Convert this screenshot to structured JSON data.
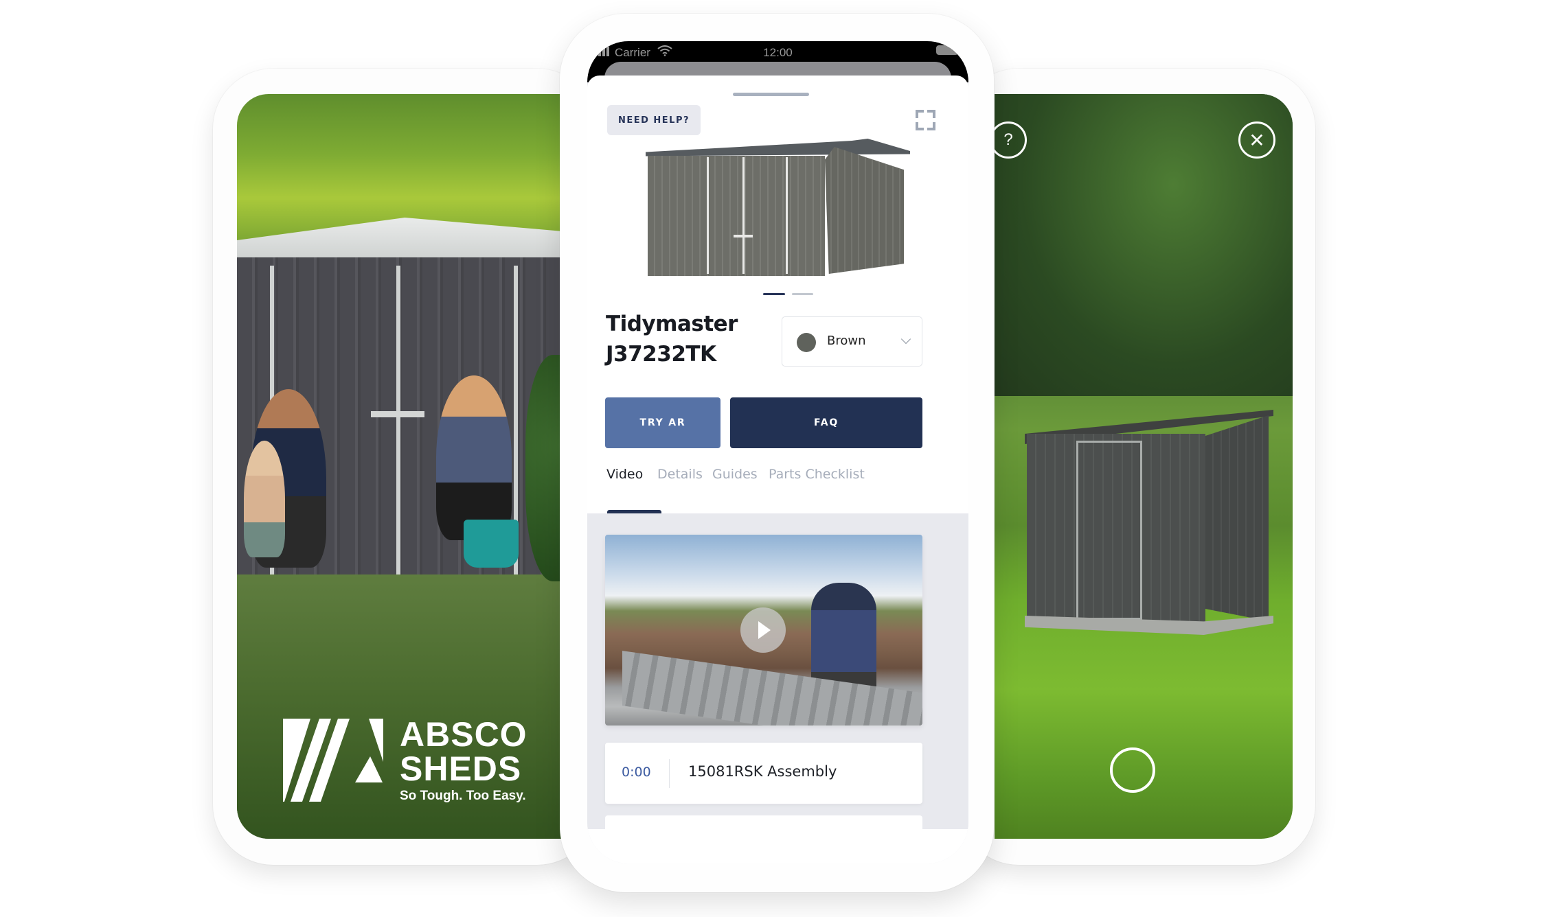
{
  "left_phone": {
    "brand": {
      "line1": "ABSCO",
      "line2": "SHEDS",
      "tagline": "So Tough. Too Easy."
    },
    "scene": "family-with-shed-photo"
  },
  "center_phone": {
    "status_bar": {
      "carrier": "Carrier",
      "time": "12:00",
      "icons": [
        "signal-icon",
        "wifi-icon",
        "battery-icon"
      ]
    },
    "header": {
      "help_button": "NEED HELP?",
      "fullscreen_icon": "fullscreen-icon"
    },
    "product": {
      "title": "Tidymaster J37232TK",
      "carousel": {
        "total": 2,
        "active": 1
      },
      "color": {
        "label": "Brown",
        "swatch": "#5f625c"
      }
    },
    "actions": {
      "try_ar": "TRY AR",
      "faq": "FAQ"
    },
    "tabs": [
      {
        "label": "Video",
        "active": true
      },
      {
        "label": "Details",
        "active": false
      },
      {
        "label": "Guides",
        "active": false
      },
      {
        "label": "Parts Checklist",
        "active": false
      }
    ],
    "videos": [
      {
        "time": "0:00",
        "title": "15081RSK Assembly"
      }
    ]
  },
  "right_phone": {
    "help_icon": "?",
    "close_icon": "✕",
    "shutter": "capture-button"
  },
  "colors": {
    "navy": "#223153",
    "accent_blue": "#5672a6",
    "link_blue": "#3b5aa0",
    "tab_inactive": "#a6adba"
  }
}
